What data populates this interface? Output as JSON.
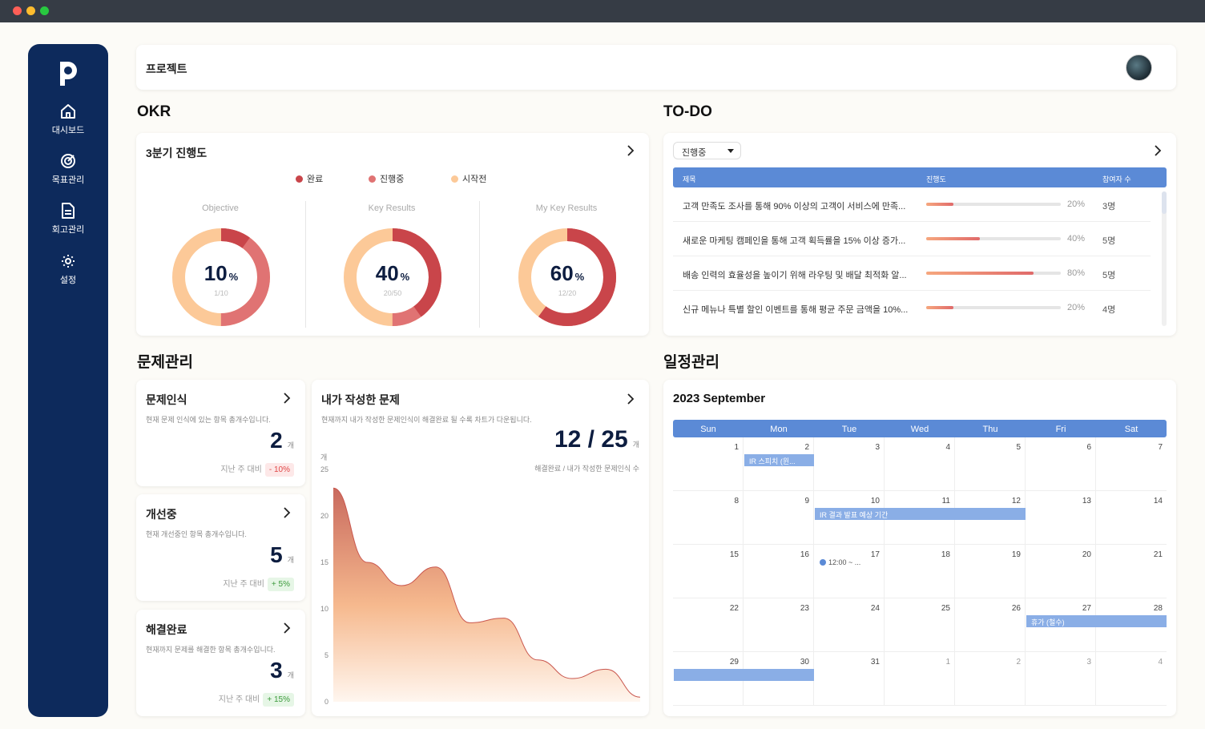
{
  "sidebar": {
    "items": [
      {
        "label": "대시보드",
        "icon": "home-icon"
      },
      {
        "label": "목표관리",
        "icon": "target-icon"
      },
      {
        "label": "회고관리",
        "icon": "document-icon"
      },
      {
        "label": "설정",
        "icon": "gear-icon"
      }
    ]
  },
  "header": {
    "title": "프로젝트"
  },
  "sections": {
    "okr": "OKR",
    "todo": "TO-DO",
    "problem": "문제관리",
    "schedule": "일정관리"
  },
  "okr": {
    "title": "3분기 진행도",
    "legend": [
      {
        "label": "완료",
        "color": "#c9454a"
      },
      {
        "label": "진행중",
        "color": "#e07373"
      },
      {
        "label": "시작전",
        "color": "#fcc998"
      }
    ],
    "columns": [
      {
        "label": "Objective",
        "value": "10",
        "unit": "%",
        "sub": "1/10",
        "percent": 10
      },
      {
        "label": "Key Results",
        "value": "40",
        "unit": "%",
        "sub": "20/50",
        "percent": 40
      },
      {
        "label": "My Key Results",
        "value": "60",
        "unit": "%",
        "sub": "12/20",
        "percent": 60
      }
    ]
  },
  "todo": {
    "filter": "진행중",
    "headers": {
      "title": "제목",
      "progress": "진행도",
      "members": "참여자 수"
    },
    "rows": [
      {
        "title": "고객 만족도 조사를 통해 90% 이상의 고객이 서비스에 만족...",
        "progress": 20,
        "progress_label": "20%",
        "members": "3명"
      },
      {
        "title": "새로운 마케팅 캠페인을 통해 고객 획득률을 15% 이상 증가...",
        "progress": 40,
        "progress_label": "40%",
        "members": "5명"
      },
      {
        "title": "배송 인력의 효율성을 높이기 위해 라우팅 및 배달 최적화 알...",
        "progress": 80,
        "progress_label": "80%",
        "members": "5명"
      },
      {
        "title": "신규 메뉴나 특별 할인 이벤트를 통해 평균 주문 금액을 10%...",
        "progress": 20,
        "progress_label": "20%",
        "members": "4명"
      }
    ]
  },
  "problems": {
    "cards": [
      {
        "title": "문제인식",
        "desc": "현재 문제 인식에 있는 항목 총개수입니다.",
        "value": "2",
        "unit": "개",
        "compare_label": "지난 주 대비",
        "change": "- 10%",
        "trend": "red"
      },
      {
        "title": "개선중",
        "desc": "현재 개선중인 항목 총개수입니다.",
        "value": "5",
        "unit": "개",
        "compare_label": "지난 주 대비",
        "change": "+ 5%",
        "trend": "green"
      },
      {
        "title": "해결완료",
        "desc": "현재까지 문제를 해결한 항목 총개수입니다.",
        "value": "3",
        "unit": "개",
        "compare_label": "지난 주 대비",
        "change": "+ 15%",
        "trend": "green"
      }
    ],
    "mine": {
      "title": "내가 작성한 문제",
      "desc": "현재까지 내가 작성한 문제인식이 해결완료 될 수록 차트가 다운됩니다.",
      "value": "12 / 25",
      "unit": "개",
      "sub": "해결완료 / 내가 작성한 문제인식 수"
    }
  },
  "chart_data": {
    "type": "area",
    "ylabel": "개",
    "ylim": [
      0,
      25
    ],
    "yticks": [
      "25",
      "20",
      "15",
      "10",
      "5",
      "0"
    ],
    "values": [
      23,
      15,
      12.5,
      14.5,
      8.5,
      9,
      4.5,
      2.5,
      3.5,
      0.5
    ]
  },
  "calendar": {
    "title": "2023 September",
    "weekdays": [
      "Sun",
      "Mon",
      "Tue",
      "Wed",
      "Thu",
      "Fri",
      "Sat"
    ],
    "weeks": [
      [
        "1",
        "2",
        "3",
        "4",
        "5",
        "6",
        "7"
      ],
      [
        "8",
        "9",
        "10",
        "11",
        "12",
        "13",
        "14"
      ],
      [
        "15",
        "16",
        "17",
        "18",
        "19",
        "20",
        "21"
      ],
      [
        "22",
        "23",
        "24",
        "25",
        "26",
        "27",
        "28"
      ],
      [
        "29",
        "30",
        "31",
        "1",
        "2",
        "3",
        "4"
      ]
    ],
    "events": [
      {
        "label": "IR 스피치 (윈..."
      },
      {
        "label": "IR 결과 발표 예상 기간"
      },
      {
        "label": "12:00 ~ ..."
      },
      {
        "label": "휴가 (철수)"
      },
      {
        "label": ""
      }
    ]
  }
}
